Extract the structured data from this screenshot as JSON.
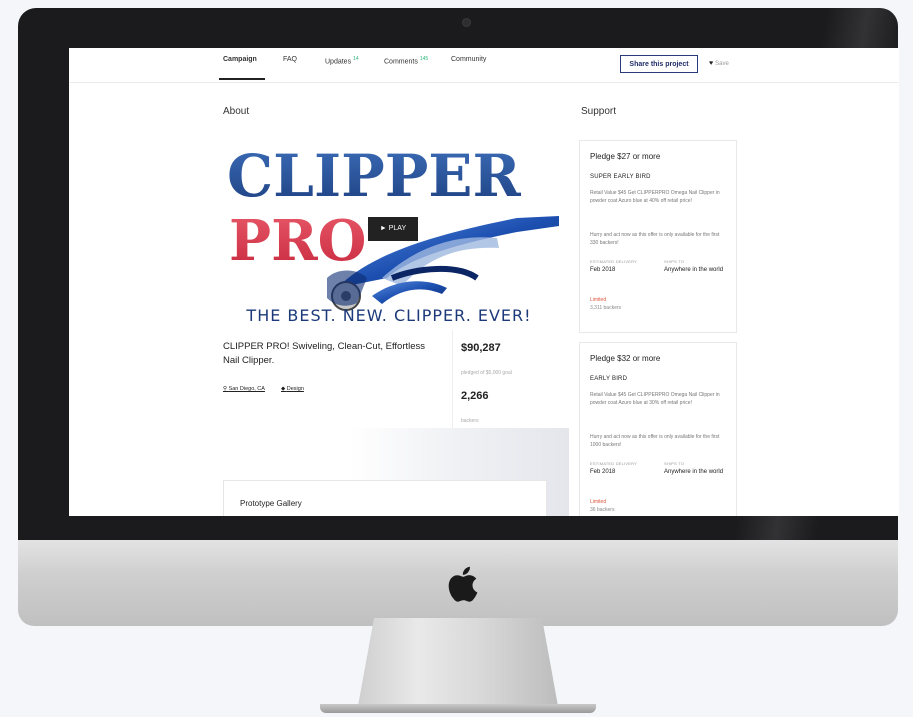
{
  "nav": {
    "tabs": [
      {
        "label": "Campaign"
      },
      {
        "label": "FAQ"
      },
      {
        "label": "Updates",
        "badge": "14"
      },
      {
        "label": "Comments",
        "badge": "145"
      },
      {
        "label": "Community"
      }
    ],
    "share_label": "Share this project",
    "save_label": "Save"
  },
  "about": {
    "heading": "About",
    "hero": {
      "logo_line1": "CLIPPER",
      "logo_line2": "PRO",
      "tagline": "THE BEST. NEW. CLIPPER. EVER!",
      "play_label": "► PLAY"
    },
    "project_title": "CLIPPER PRO! Swiveling, Clean-Cut, Effortless Nail Clipper.",
    "location": "San Diego, CA",
    "category": "Design",
    "pledged": "$90,287",
    "pledged_caption": "pledged of $5,000 goal",
    "backers": "2,266",
    "backers_caption": "backers",
    "gallery_title": "Prototype Gallery"
  },
  "support": {
    "heading": "Support",
    "rewards": [
      {
        "pledge": "Pledge $27 or more",
        "tier": "SUPER EARLY BIRD",
        "description": "Retail Value $45 Get CLIPPERPRO Omega Nail Clipper in powder coat Azuro blue at 40% off retail price!",
        "hurry": "Hurry and act now as this offer is only available for the first 330 backers!",
        "delivery_label": "ESTIMATED DELIVERY",
        "delivery": "Feb 2018",
        "ships_label": "SHIPS TO",
        "ships": "Anywhere in the world",
        "limited": "Limited",
        "backers": "3,311 backers"
      },
      {
        "pledge": "Pledge $32 or more",
        "tier": "EARLY BIRD",
        "description": "Retail Value $45 Get CLIPPERPRO Omega Nail Clipper in powder coat Azuro blue at 30% off retail price!",
        "hurry": "Hurry and act now as this offer is only available for the first 1000 backers!",
        "delivery_label": "ESTIMATED DELIVERY",
        "delivery": "Feb 2018",
        "ships_label": "SHIPS TO",
        "ships": "Anywhere in the world",
        "limited": "Limited",
        "backers": "36 backers"
      }
    ]
  },
  "colors": {
    "accent": "#2a3a7a",
    "logo_blue": "#2d5aa5",
    "logo_red": "#d8334a",
    "limited": "#e0533d"
  }
}
